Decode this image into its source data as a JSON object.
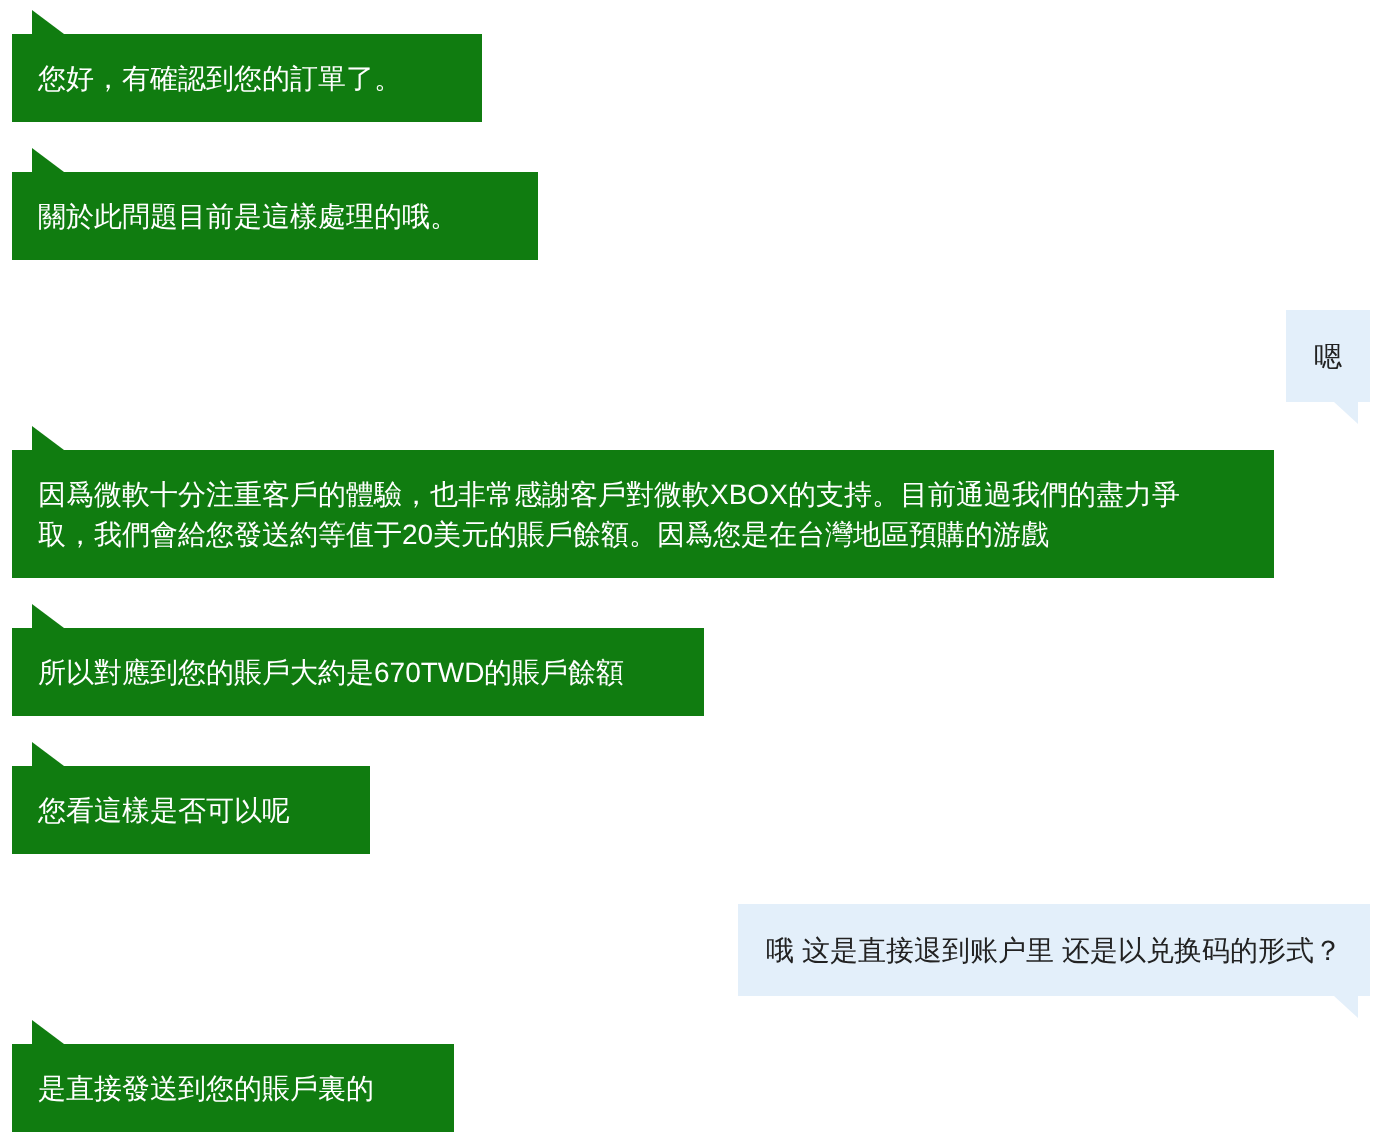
{
  "messages": [
    {
      "kind": "agent",
      "text": "您好，有確認到您的訂單了。"
    },
    {
      "kind": "agent",
      "text": "關於此問題目前是這樣處理的哦。"
    },
    {
      "kind": "user",
      "text": "嗯"
    },
    {
      "kind": "agent",
      "text": "因爲微軟十分注重客戶的體驗，也非常感謝客戶對微軟XBOX的支持。目前通過我們的盡力爭取，我們會給您發送約等值于20美元的賬戶餘額。因爲您是在台灣地區預購的游戲"
    },
    {
      "kind": "agent",
      "text": "所以對應到您的賬戶大約是670TWD的賬戶餘額"
    },
    {
      "kind": "agent",
      "text": "您看這樣是否可以呢"
    },
    {
      "kind": "user",
      "text": "哦 这是直接退到账户里 还是以兑换码的形式？"
    },
    {
      "kind": "agent",
      "text": "是直接發送到您的賬戶裏的"
    }
  ]
}
